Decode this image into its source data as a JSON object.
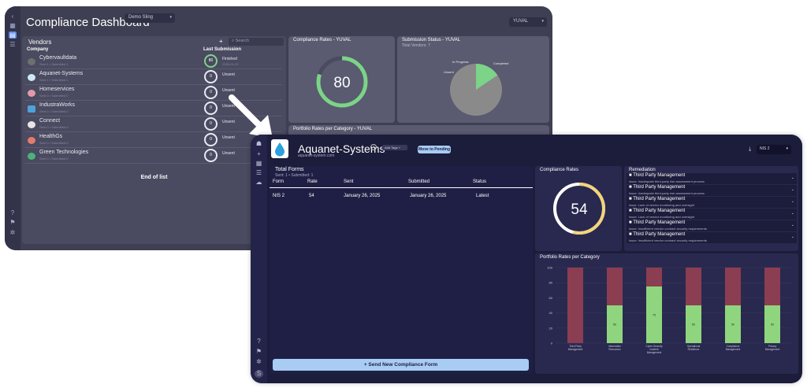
{
  "back": {
    "title": "Compliance Dashboard",
    "org_select": "Demo Sling",
    "user_select": "YUVAL",
    "vendors": {
      "title": "Vendors",
      "add": "+",
      "search_placeholder": "Search",
      "col_company": "Company",
      "col_last_submission": "Last Submission",
      "end_of_list": "End of list",
      "rows": [
        {
          "name": "Cybervaultdata",
          "sub": "Sent 1 • Submitted 1",
          "score": "80",
          "status": "Finished",
          "date": "2025-01-23"
        },
        {
          "name": "Aquanet-Systems",
          "sub": "Sent 1 • Submitted 1",
          "score": "0",
          "status": "Unsent",
          "date": ""
        },
        {
          "name": "Homeservices",
          "sub": "Sent 0 • Submitted 0",
          "score": "0",
          "status": "Unsent",
          "date": ""
        },
        {
          "name": "IndustraWorks",
          "sub": "Sent 0 • Submitted 0",
          "score": "0",
          "status": "Unsent",
          "date": ""
        },
        {
          "name": "Connect",
          "sub": "Sent 0 • Submitted 0",
          "score": "0",
          "status": "Unsent",
          "date": ""
        },
        {
          "name": "HealthGs",
          "sub": "Sent 0 • Submitted 0",
          "score": "0",
          "status": "Unsent",
          "date": ""
        },
        {
          "name": "Green Technologies",
          "sub": "Sent 0 • Submitted 0",
          "score": "0",
          "status": "Unsent",
          "date": ""
        }
      ]
    },
    "compliance_rates": {
      "title": "Compliance Rates - YUVAL",
      "value": "80",
      "fraction": 0.8
    },
    "submission_status": {
      "title": "Submission Status - YUVAL",
      "subtitle": "Total Vendors: 7",
      "labels": [
        "In Progress",
        "Completed",
        "Unsent"
      ]
    },
    "portfolio": {
      "title": "Portfolio Rates per Category - YUVAL"
    },
    "colors": {
      "green": "#7bd487",
      "gray": "#8a8a8a"
    }
  },
  "front": {
    "vendor_name": "Aquanet-Systems",
    "vendor_url": "aquanet-system.com",
    "add_tags": "Add Tags +",
    "move_pending": "Move to Pending",
    "framework": "NIS 2",
    "total_forms": {
      "title": "Total Forms",
      "subtitle": "Sent: 1 • Submitted: 1",
      "headers": [
        "Form",
        "Rate",
        "Sent",
        "Submitted",
        "Status"
      ],
      "rows": [
        {
          "form": "NIS 2",
          "rate": "54",
          "sent": "January 26, 2025",
          "submitted": "January 26, 2025",
          "status": "Latest"
        }
      ]
    },
    "send_button": "+ Send New Compliance Form",
    "compliance_rates": {
      "title": "Compliance Rates",
      "value": "54",
      "fraction": 0.54,
      "color": "#f4d47a"
    },
    "remediation": {
      "title": "Remediation",
      "items": [
        {
          "title": "Third Party Management",
          "issue": "Issue: Inadequate third-party risk assessment process"
        },
        {
          "title": "Third Party Management",
          "issue": "Issue: Inadequate third-party risk assessment process"
        },
        {
          "title": "Third Party Management",
          "issue": "Issue: Lack of vendor monitoring and oversight"
        },
        {
          "title": "Third Party Management",
          "issue": "Issue: Lack of vendor monitoring and oversight"
        },
        {
          "title": "Third Party Management",
          "issue": "Issue: Insufficient vendor contract security requirements"
        },
        {
          "title": "Third Party Management",
          "issue": "Issue: Insufficient vendor contract security requirements"
        }
      ]
    },
    "portfolio_rates": {
      "title": "Portfolio Rates per Category"
    }
  },
  "chart_data": {
    "type": "bar",
    "categories": [
      "Third Party Management",
      "Information Resources",
      "Cyber Security Incident Management",
      "Operational Resilience",
      "Compliance Management",
      "Privacy Management"
    ],
    "ylim": [
      0,
      100
    ],
    "yticks": [
      0,
      20,
      40,
      60,
      80,
      100
    ],
    "series": [
      {
        "values": [
          0,
          50,
          75,
          50,
          50,
          50
        ],
        "color": "#8fd57e"
      },
      {
        "values": [
          100,
          50,
          25,
          50,
          50,
          50
        ],
        "color": "#8b3d51"
      }
    ],
    "data_labels": [
      "",
      "50",
      "75",
      "50",
      "50",
      "50"
    ]
  }
}
